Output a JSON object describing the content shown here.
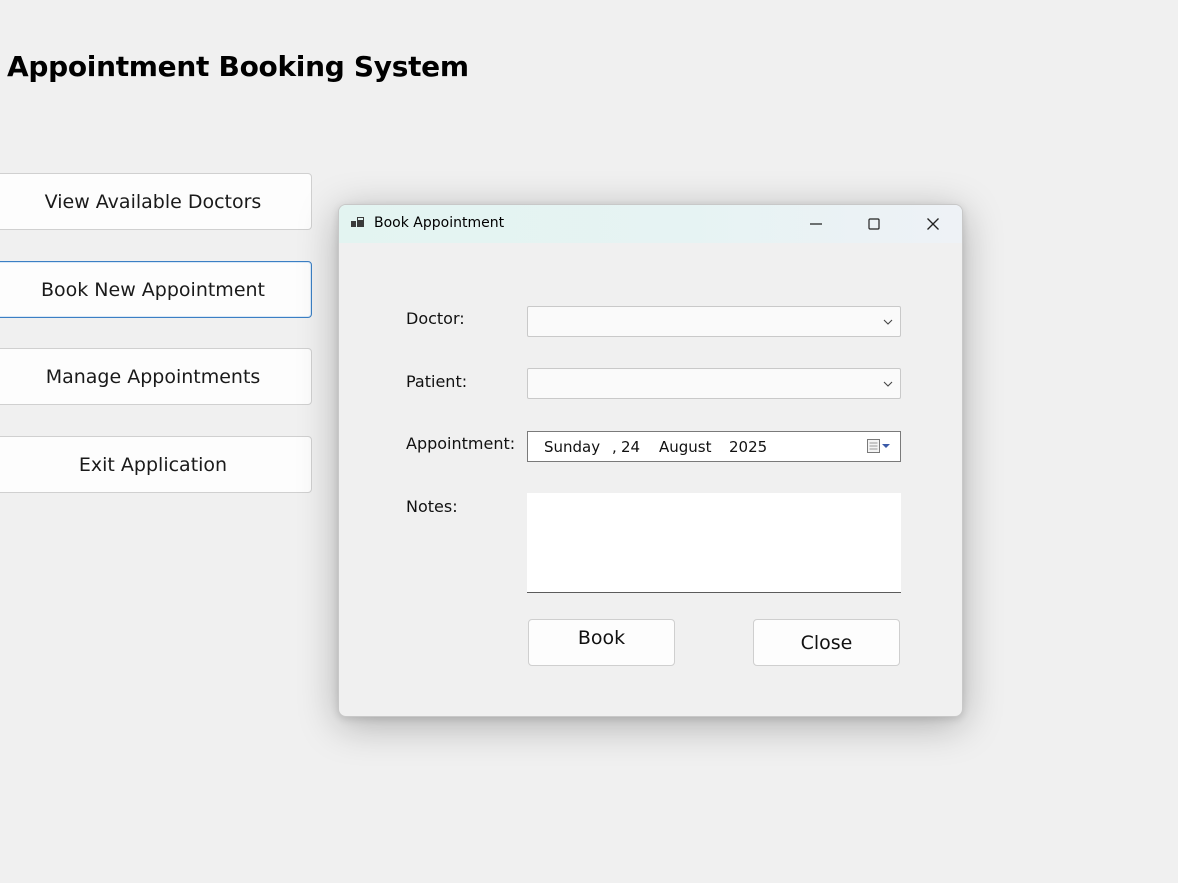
{
  "app": {
    "title": "Appointment Booking System"
  },
  "menu": {
    "items": [
      {
        "label": "View Available Doctors"
      },
      {
        "label": "Book New Appointment"
      },
      {
        "label": "Manage Appointments"
      },
      {
        "label": "Exit Application"
      }
    ]
  },
  "dialog": {
    "title": "Book Appointment",
    "icons": {
      "app": "form-app-icon",
      "minimize": "minimize-icon",
      "maximize": "maximize-icon",
      "close": "close-icon"
    },
    "fields": {
      "doctor_label": "Doctor:",
      "doctor_value": "",
      "patient_label": "Patient:",
      "patient_value": "",
      "appointment_label": "Appointment:",
      "appointment_date": {
        "weekday": "Sunday",
        "separator": ",",
        "day": "24",
        "month": "August",
        "year": "2025"
      },
      "notes_label": "Notes:",
      "notes_value": ""
    },
    "buttons": {
      "book": "Book",
      "close": "Close"
    }
  },
  "colors": {
    "background": "#f0f0f0",
    "focus_border": "#3b7fc4",
    "titlebar_tint": "#e3f4f1"
  }
}
